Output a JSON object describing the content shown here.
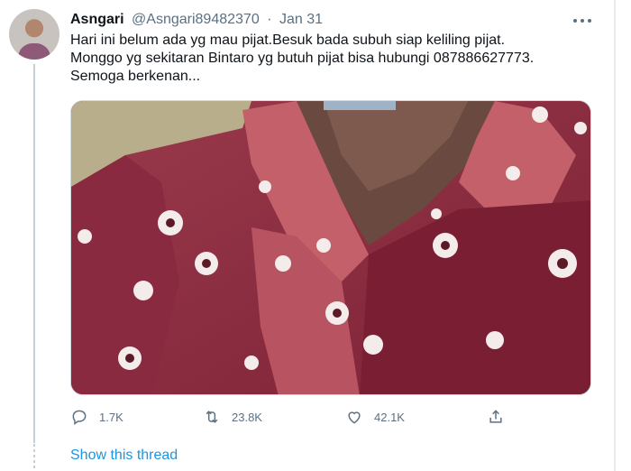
{
  "tweet": {
    "author_name": "Asngari",
    "handle": "@Asngari89482370",
    "separator": "·",
    "date": "Jan 31",
    "text": "Hari ini belum ada yg mau pijat.Besuk bada subuh siap keliling pijat.\nMonggo yg sekitaran Bintaro yg butuh pijat bisa hubungi 087886627773.\nSemoga berkenan...",
    "media": {
      "type": "photo",
      "subject": "person in red patterned shirt"
    },
    "actions": {
      "reply_count": "1.7K",
      "retweet_count": "23.8K",
      "like_count": "42.1K"
    },
    "show_thread_label": "Show this thread"
  },
  "icons": {
    "more": "more-horizontal-icon",
    "reply": "reply-icon",
    "retweet": "retweet-icon",
    "like": "heart-icon",
    "share": "share-icon"
  },
  "colors": {
    "secondary_text": "#5b7083",
    "link": "#1b95e0",
    "thread_line": "#c4cfd6",
    "shirt_red": "#8f2e43"
  }
}
